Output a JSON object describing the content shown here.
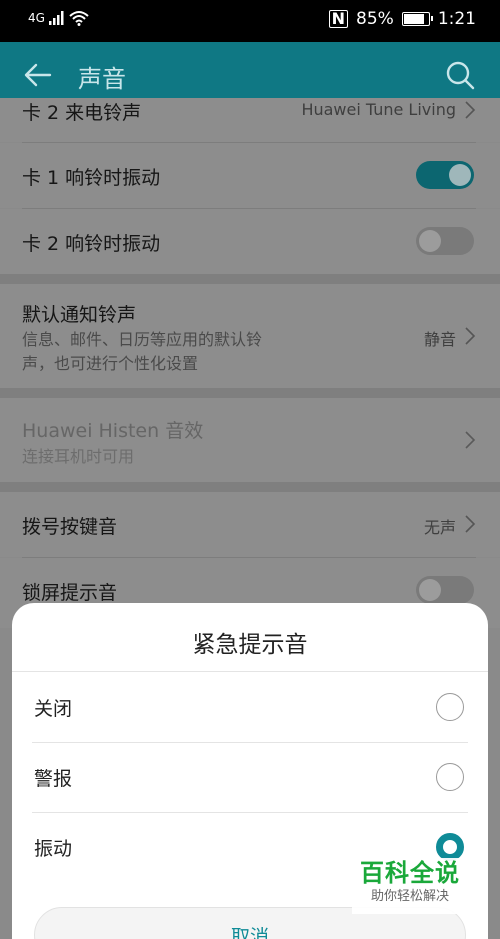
{
  "status_bar": {
    "network": "4G",
    "battery_percent": "85%",
    "battery_level": 0.85,
    "time": "1:21",
    "signal_icon": "signal-icon",
    "wifi_icon": "wifi-icon",
    "nfc_icon": "nfc-icon"
  },
  "app_bar": {
    "title": "声音",
    "back_icon": "back-arrow-icon",
    "search_icon": "search-icon"
  },
  "settings": {
    "card2_ringtone": {
      "label": "卡 2 来电铃声",
      "value": "Huawei Tune Living"
    },
    "card1_vibrate": {
      "label": "卡 1 响铃时振动",
      "on": true
    },
    "card2_vibrate": {
      "label": "卡 2 响铃时振动",
      "on": false
    },
    "notification_tone": {
      "label": "默认通知铃声",
      "desc_line1": "信息、邮件、日历等应用的默认铃",
      "desc_line2": "声，也可进行个性化设置",
      "value": "静音"
    },
    "histen": {
      "label": "Huawei Histen 音效",
      "desc": "连接耳机时可用"
    },
    "dial_tone": {
      "label": "拨号按键音",
      "value": "无声"
    },
    "lock_sound": {
      "label": "锁屏提示音",
      "on": false
    }
  },
  "dialog": {
    "title": "紧急提示音",
    "options": [
      {
        "label": "关闭",
        "selected": false
      },
      {
        "label": "警报",
        "selected": false
      },
      {
        "label": "振动",
        "selected": true
      }
    ],
    "cancel_label": "取消"
  },
  "watermark": {
    "main": "百科全说",
    "sub": "助你轻松解决"
  },
  "colors": {
    "accent": "#0f8b97",
    "app_bar": "#0f7884"
  }
}
